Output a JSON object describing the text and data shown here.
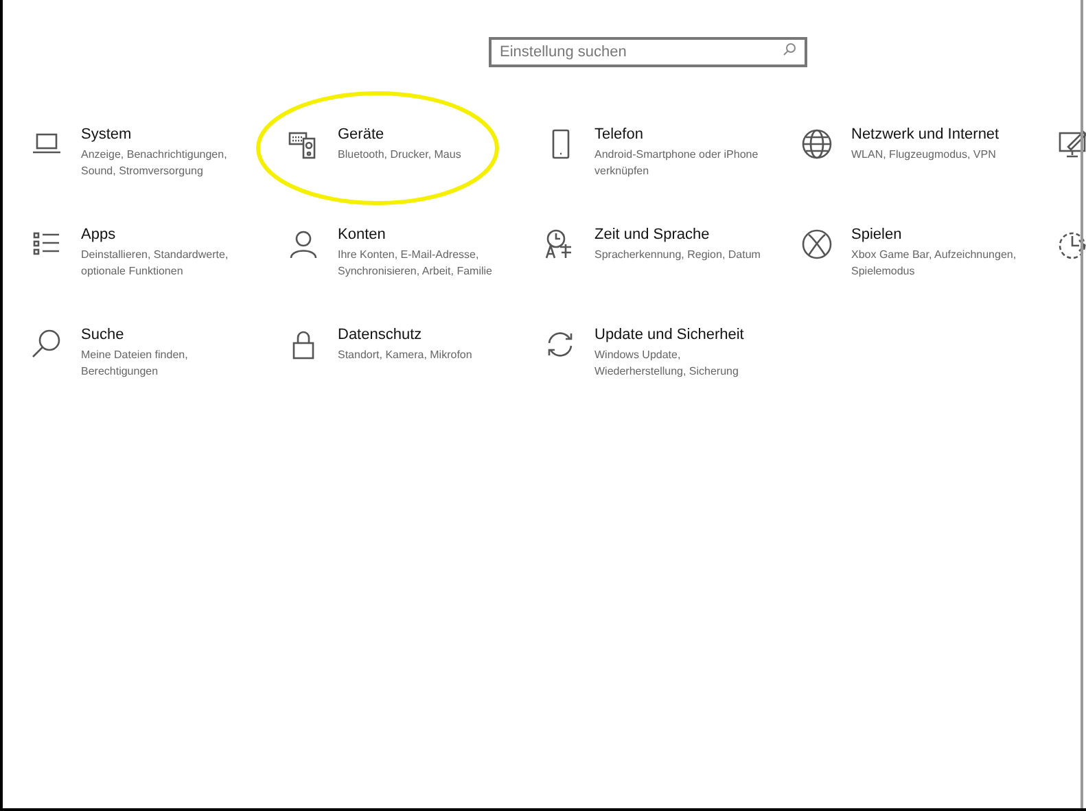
{
  "search": {
    "placeholder": "Einstellung suchen"
  },
  "categories": [
    {
      "title": "System",
      "description": "Anzeige, Benachrichtigungen, Sound, Stromversorgung",
      "highlighted": false
    },
    {
      "title": "Geräte",
      "description": "Bluetooth, Drucker, Maus",
      "highlighted": true
    },
    {
      "title": "Telefon",
      "description": "Android-Smartphone oder iPhone verknüpfen",
      "highlighted": false
    },
    {
      "title": "Netzwerk und Internet",
      "description": "WLAN, Flugzeugmodus, VPN",
      "highlighted": false
    },
    {
      "title": "Apps",
      "description": "Deinstallieren, Standardwerte, optionale Funktionen",
      "highlighted": false
    },
    {
      "title": "Konten",
      "description": "Ihre Konten, E-Mail-Adresse, Synchronisieren, Arbeit, Familie",
      "highlighted": false
    },
    {
      "title": "Zeit und Sprache",
      "description": "Spracherkennung, Region, Datum",
      "highlighted": false
    },
    {
      "title": "Spielen",
      "description": "Xbox Game Bar, Aufzeichnungen, Spielemodus",
      "highlighted": false
    },
    {
      "title": "Suche",
      "description": "Meine Dateien finden, Berechtigungen",
      "highlighted": false
    },
    {
      "title": "Datenschutz",
      "description": "Standort, Kamera, Mikrofon",
      "highlighted": false
    },
    {
      "title": "Update und Sicherheit",
      "description": "Windows Update, Wiederherstellung, Sicherung",
      "highlighted": false
    }
  ]
}
